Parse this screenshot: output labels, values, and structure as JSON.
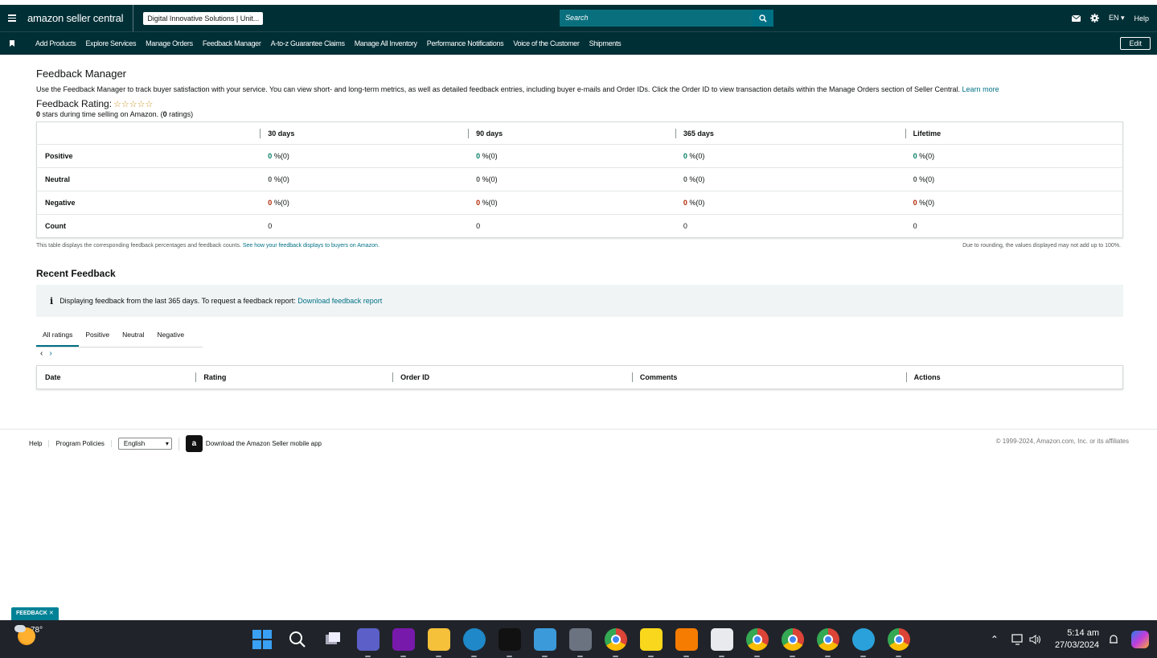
{
  "header": {
    "logo_text": "amazon seller central",
    "account": "Digital Innovative Solutions | Unit...",
    "search_placeholder": "Search",
    "lang": "EN",
    "help": "Help"
  },
  "nav": {
    "items": [
      "Add Products",
      "Explore Services",
      "Manage Orders",
      "Feedback Manager",
      "A-to-z Guarantee Claims",
      "Manage All Inventory",
      "Performance Notifications",
      "Voice of the Customer",
      "Shipments"
    ],
    "edit": "Edit"
  },
  "page": {
    "title": "Feedback Manager",
    "description": "Use the Feedback Manager to track buyer satisfaction with your service. You can view short- and long-term metrics, as well as detailed feedback entries, including buyer e-mails and Order IDs. Click the Order ID to view transaction details within the Manage Orders section of Seller Central.",
    "learn_more": "Learn more",
    "rating_label": "Feedback Rating:",
    "stars": "☆☆☆☆☆",
    "stars_count": "0",
    "stars_sub_a": " stars during time selling on Amazon. (",
    "ratings_count": "0",
    "stars_sub_b": " ratings)"
  },
  "feedback_table": {
    "columns": [
      "30 days",
      "90 days",
      "365 days",
      "Lifetime"
    ],
    "rows": [
      {
        "label": "Positive",
        "values": [
          "0",
          "0",
          "0",
          "0"
        ],
        "suffix": " %(0)"
      },
      {
        "label": "Neutral",
        "values": [
          "0",
          "0",
          "0",
          "0"
        ],
        "suffix": " %(0)"
      },
      {
        "label": "Negative",
        "values": [
          "0",
          "0",
          "0",
          "0"
        ],
        "suffix": " %(0)"
      },
      {
        "label": "Count",
        "values": [
          "0",
          "0",
          "0",
          "0"
        ],
        "suffix": ""
      }
    ],
    "note_left": "This table displays the corresponding feedback percentages and feedback counts.",
    "note_link": "See how your feedback displays to buyers on Amazon.",
    "note_right": "Due to rounding, the values displayed may not add up to 100%."
  },
  "recent": {
    "title": "Recent Feedback",
    "info_icon": "i",
    "info_text": "Displaying feedback from the last 365 days. To request a feedback report:",
    "info_link": "Download feedback report",
    "tabs": [
      "All ratings",
      "Positive",
      "Neutral",
      "Negative"
    ],
    "prev": "‹",
    "next": "›",
    "columns": [
      "Date",
      "Rating",
      "Order ID",
      "Comments",
      "Actions"
    ]
  },
  "footer": {
    "help": "Help",
    "policies": "Program Policies",
    "language": "English",
    "app_icon": "a",
    "app_text": "Download the Amazon Seller mobile app",
    "copyright": "© 1999-2024, Amazon.com, Inc. or its affiliates"
  },
  "feedback_tag": "FEEDBACK ✕",
  "taskbar": {
    "temp": "78°",
    "time": "5:14 am",
    "date": "27/03/2024",
    "apps": [
      {
        "name": "start-icon",
        "color": "#3aa0f3"
      },
      {
        "name": "search-icon",
        "color": "#20242a"
      },
      {
        "name": "task-view-icon",
        "color": "#20242a"
      },
      {
        "name": "teams-icon",
        "color": "#5b5fc7"
      },
      {
        "name": "onenote-icon",
        "color": "#7719aa"
      },
      {
        "name": "file-explorer-icon",
        "color": "#f5c03a"
      },
      {
        "name": "edge-icon",
        "color": "#1e88c8"
      },
      {
        "name": "netflix-icon",
        "color": "#111111"
      },
      {
        "name": "notepad-icon",
        "color": "#3b9ad9"
      },
      {
        "name": "calculator-icon",
        "color": "#6b7280"
      },
      {
        "name": "chrome-icon",
        "color": "#db4437"
      },
      {
        "name": "sticky-notes-icon",
        "color": "#f9d71c"
      },
      {
        "name": "remote-icon",
        "color": "#f57c00"
      },
      {
        "name": "snipping-tool-icon",
        "color": "#e8eaed"
      },
      {
        "name": "chrome-profile-1-icon",
        "color": "#34a853"
      },
      {
        "name": "chrome-profile-2-icon",
        "color": "#4285f4"
      },
      {
        "name": "chrome-profile-3-icon",
        "color": "#fbbc05"
      },
      {
        "name": "telegram-icon",
        "color": "#2aa1da"
      },
      {
        "name": "chrome-profile-4-icon",
        "color": "#db4437"
      }
    ]
  }
}
